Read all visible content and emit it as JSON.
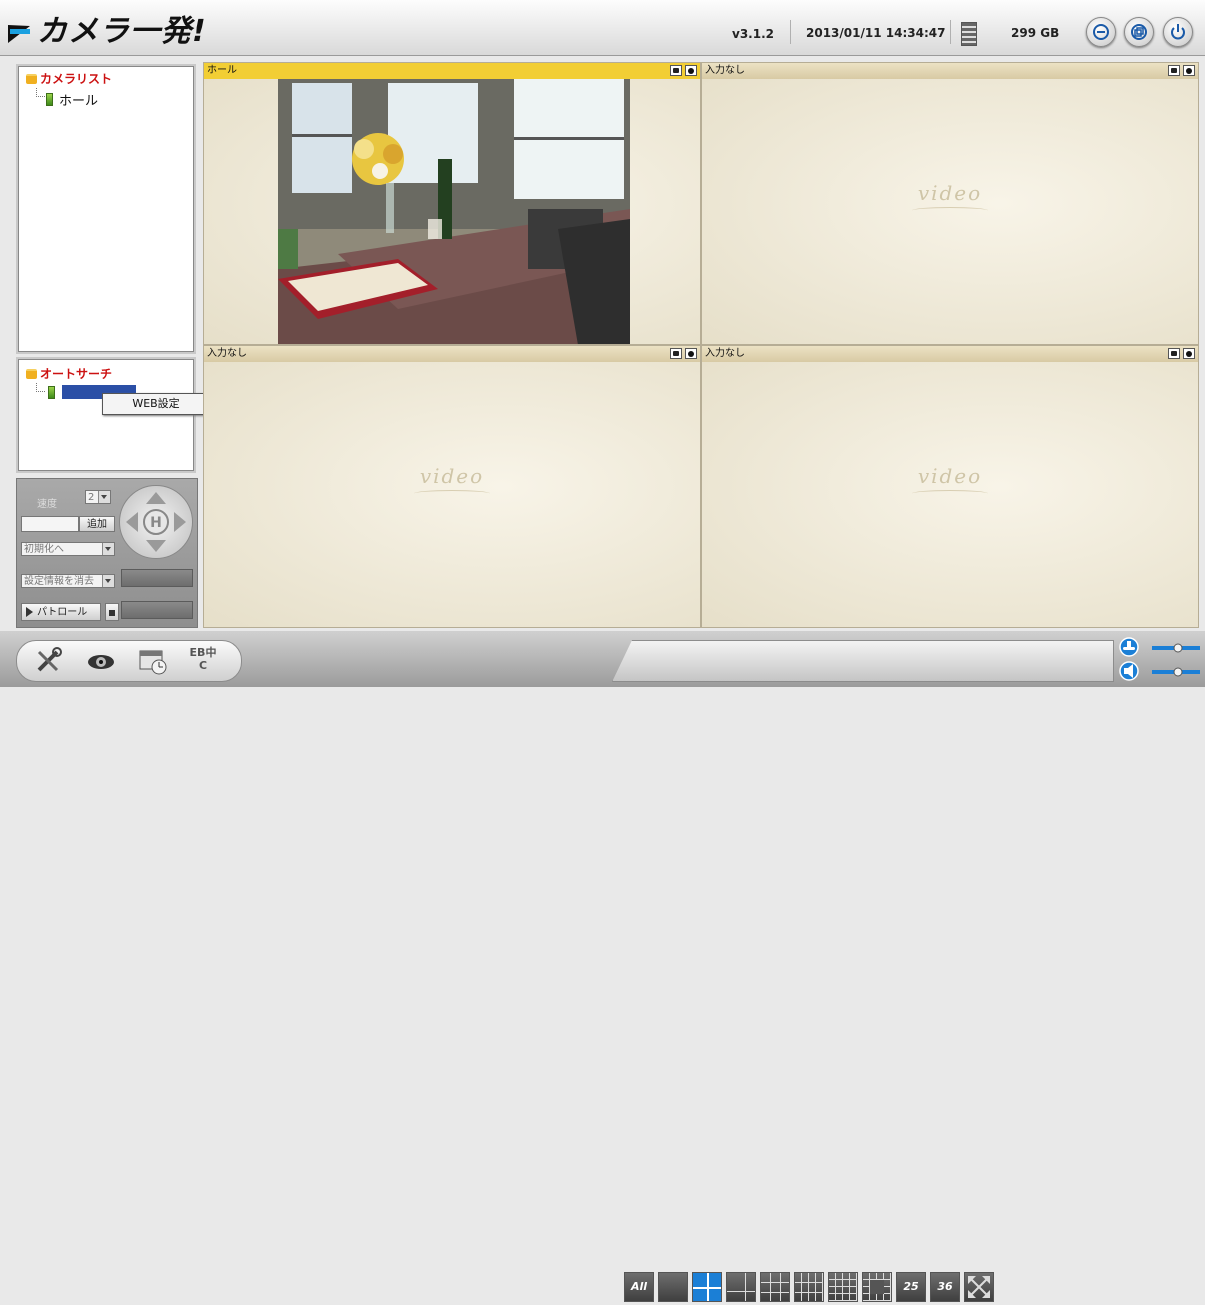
{
  "header": {
    "app_title": "カメラ一発!",
    "version": "v3.1.2",
    "datetime": "2013/01/11 14:34:47",
    "disk_free": "299 GB",
    "buttons": [
      "minimize-icon",
      "restore-icon",
      "power-icon"
    ]
  },
  "camera_list": {
    "root_label": "カメラリスト",
    "items": [
      {
        "label": "ホール"
      }
    ]
  },
  "auto_search": {
    "root_label": "オートサーチ",
    "context_menu_item": "WEB設定"
  },
  "ptz": {
    "speed_label": "速度",
    "speed_value": "2",
    "add_label": "追加",
    "reset_label": "初期化へ",
    "clear_settings_label": "設定情報を消去",
    "patrol_label": "パトロール"
  },
  "video": {
    "cells": [
      {
        "title": "ホール",
        "active": true,
        "has_image": true
      },
      {
        "title": "入力なし",
        "active": false,
        "watermark": "video"
      },
      {
        "title": "入力なし",
        "active": false,
        "watermark": "video"
      },
      {
        "title": "入力なし",
        "active": false,
        "watermark": "video"
      }
    ]
  },
  "footer": {
    "tools": [
      "settings-icon",
      "record-icon",
      "schedule-icon",
      "language-icon"
    ],
    "language_text": "EB中C",
    "layouts": [
      "All",
      "1",
      "4",
      "6",
      "8",
      "9",
      "16",
      "13",
      "25",
      "36",
      "fullscreen"
    ],
    "selected_layout": "4",
    "layout_text_all": "All",
    "layout_text_25": "25",
    "layout_text_36": "36"
  },
  "colors": {
    "active_title": "#f2ce34",
    "tree_root": "#cc1111",
    "selected_layout": "#1b7fd6"
  }
}
